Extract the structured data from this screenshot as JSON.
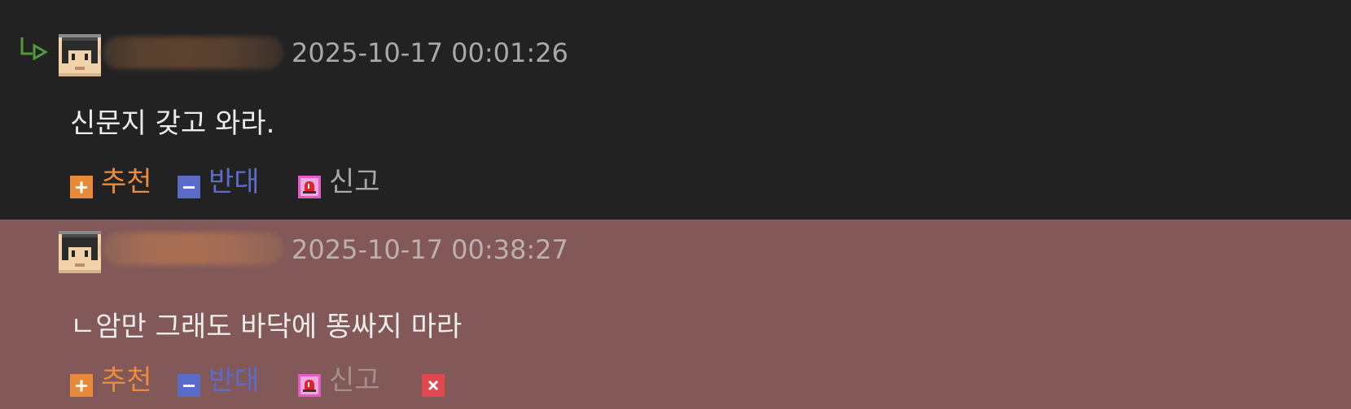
{
  "comments": [
    {
      "is_reply": true,
      "timestamp": "2025-10-17 00:01:26",
      "text": "신문지 갖고 와라.",
      "actions": {
        "upvote_label": "추천",
        "downvote_label": "반대",
        "report_label": "신고"
      },
      "has_delete": false
    },
    {
      "is_reply": false,
      "timestamp": "2025-10-17 00:38:27",
      "text": "ㄴ암만 그래도 바닥에 똥싸지 마라",
      "actions": {
        "upvote_label": "추천",
        "downvote_label": "반대",
        "report_label": "신고"
      },
      "has_delete": true
    }
  ],
  "colors": {
    "comment_bg": "#222222",
    "highlight_bg": "#825958",
    "upvote": "#eb8b3b",
    "downvote": "#5b6bc9",
    "report_icon": "#e65ac3",
    "delete_icon": "#e0484f",
    "reply_arrow": "#4f9a3c"
  },
  "icons": {
    "reply": "reply-arrow-icon",
    "avatar": "pixel-avatar-icon",
    "upvote": "plus-icon",
    "downvote": "minus-icon",
    "report": "siren-icon",
    "delete": "close-icon"
  }
}
